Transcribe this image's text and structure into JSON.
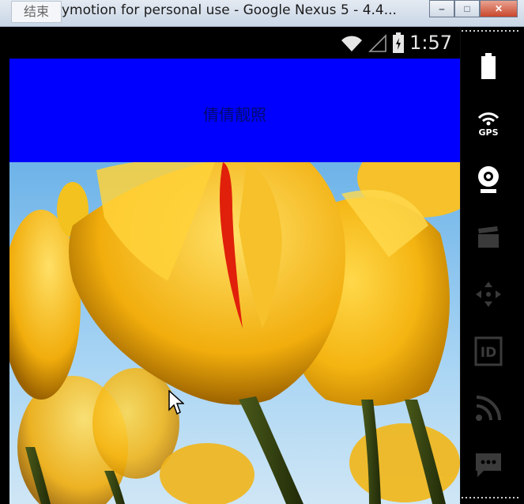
{
  "window": {
    "end_button": "结束",
    "title": "ymotion for personal use - Google Nexus 5 - 4.4...",
    "minimize": "‒",
    "maximize": "□",
    "close": "✕"
  },
  "statusbar": {
    "time": "1:57"
  },
  "app": {
    "header_title": "倩倩靓照",
    "header_color": "#0000ff"
  },
  "sidebar": {
    "items": [
      {
        "name": "battery-icon",
        "label": ""
      },
      {
        "name": "gps-icon",
        "label": "GPS"
      },
      {
        "name": "webcam-icon",
        "label": ""
      },
      {
        "name": "clapper-icon",
        "label": ""
      },
      {
        "name": "dpad-icon",
        "label": ""
      },
      {
        "name": "id-icon",
        "label": "ID"
      },
      {
        "name": "rss-icon",
        "label": ""
      },
      {
        "name": "sms-icon",
        "label": ""
      }
    ]
  }
}
